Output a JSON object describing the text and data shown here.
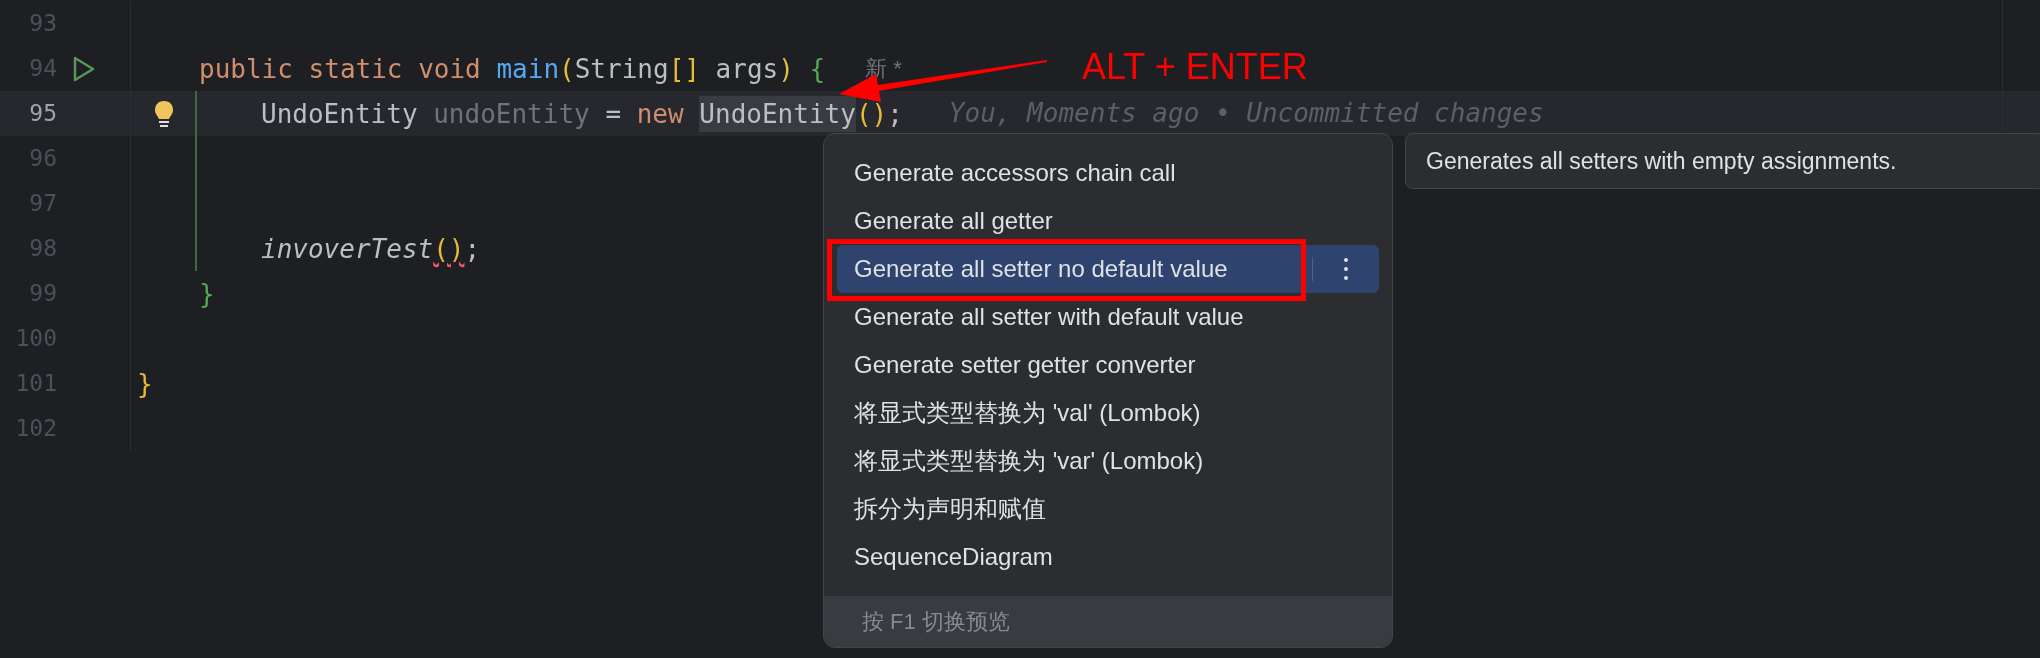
{
  "editor": {
    "lines": [
      {
        "number": "93",
        "current": false,
        "modified": false
      },
      {
        "number": "94",
        "current": false,
        "modified": false,
        "run_marker": true,
        "kind": "member",
        "tokens": [
          {
            "text": "public ",
            "kind": "keyword"
          },
          {
            "text": "static ",
            "kind": "keyword"
          },
          {
            "text": "void ",
            "kind": "keyword"
          },
          {
            "text": "main",
            "kind": "method"
          },
          {
            "text": "(",
            "kind": "paren"
          },
          {
            "text": "String",
            "kind": "plain"
          },
          {
            "text": "[]",
            "kind": "paren"
          },
          {
            "text": " args",
            "kind": "plain"
          },
          {
            "text": ")",
            "kind": "paren"
          },
          {
            "text": " {",
            "kind": "brace"
          }
        ],
        "hint": "新 *"
      },
      {
        "number": "95",
        "current": true,
        "modified": true,
        "bulb": true,
        "kind": "statement",
        "tokens": [
          {
            "text": "UndoEntity ",
            "kind": "plain"
          },
          {
            "text": "undoEntity",
            "kind": "unused"
          },
          {
            "text": " = ",
            "kind": "plain"
          },
          {
            "text": "new ",
            "kind": "keyword"
          },
          {
            "text": "UndoEntity",
            "kind": "reference"
          },
          {
            "text": "()",
            "kind": "paren"
          },
          {
            "text": ";",
            "kind": "plain"
          }
        ],
        "blame": "You, Moments ago • Uncommitted changes"
      },
      {
        "number": "96",
        "current": false,
        "modified": true
      },
      {
        "number": "97",
        "current": false,
        "modified": true
      },
      {
        "number": "98",
        "current": false,
        "modified": true,
        "kind": "statement",
        "tokens": [
          {
            "text": "invoverTest",
            "kind": "call"
          },
          {
            "text": "()",
            "kind": "error_paren"
          },
          {
            "text": ";",
            "kind": "plain"
          }
        ]
      },
      {
        "number": "99",
        "current": false,
        "modified": false,
        "kind": "member",
        "tokens": [
          {
            "text": "}",
            "kind": "brace"
          }
        ]
      },
      {
        "number": "100",
        "current": false,
        "modified": false
      },
      {
        "number": "101",
        "current": false,
        "modified": false,
        "tokens": [
          {
            "text": "}",
            "kind": "paren"
          }
        ]
      },
      {
        "number": "102",
        "current": false,
        "modified": false
      }
    ]
  },
  "intention_menu": {
    "items": [
      {
        "label": "Generate accessors chain call",
        "selected": false
      },
      {
        "label": "Generate all getter",
        "selected": false
      },
      {
        "label": "Generate all setter no default value",
        "selected": true
      },
      {
        "label": "Generate all setter with default value",
        "selected": false
      },
      {
        "label": "Generate setter getter converter",
        "selected": false
      },
      {
        "label": "将显式类型替换为 'val' (Lombok)",
        "selected": false
      },
      {
        "label": "将显式类型替换为 'var' (Lombok)",
        "selected": false
      },
      {
        "label": "拆分为声明和赋值",
        "selected": false
      },
      {
        "label": "SequenceDiagram",
        "selected": false
      }
    ],
    "footer": "按 F1 切换预览"
  },
  "tooltip": "Generates all setters with empty assignments.",
  "annotation": {
    "label": "ALT + ENTER"
  }
}
